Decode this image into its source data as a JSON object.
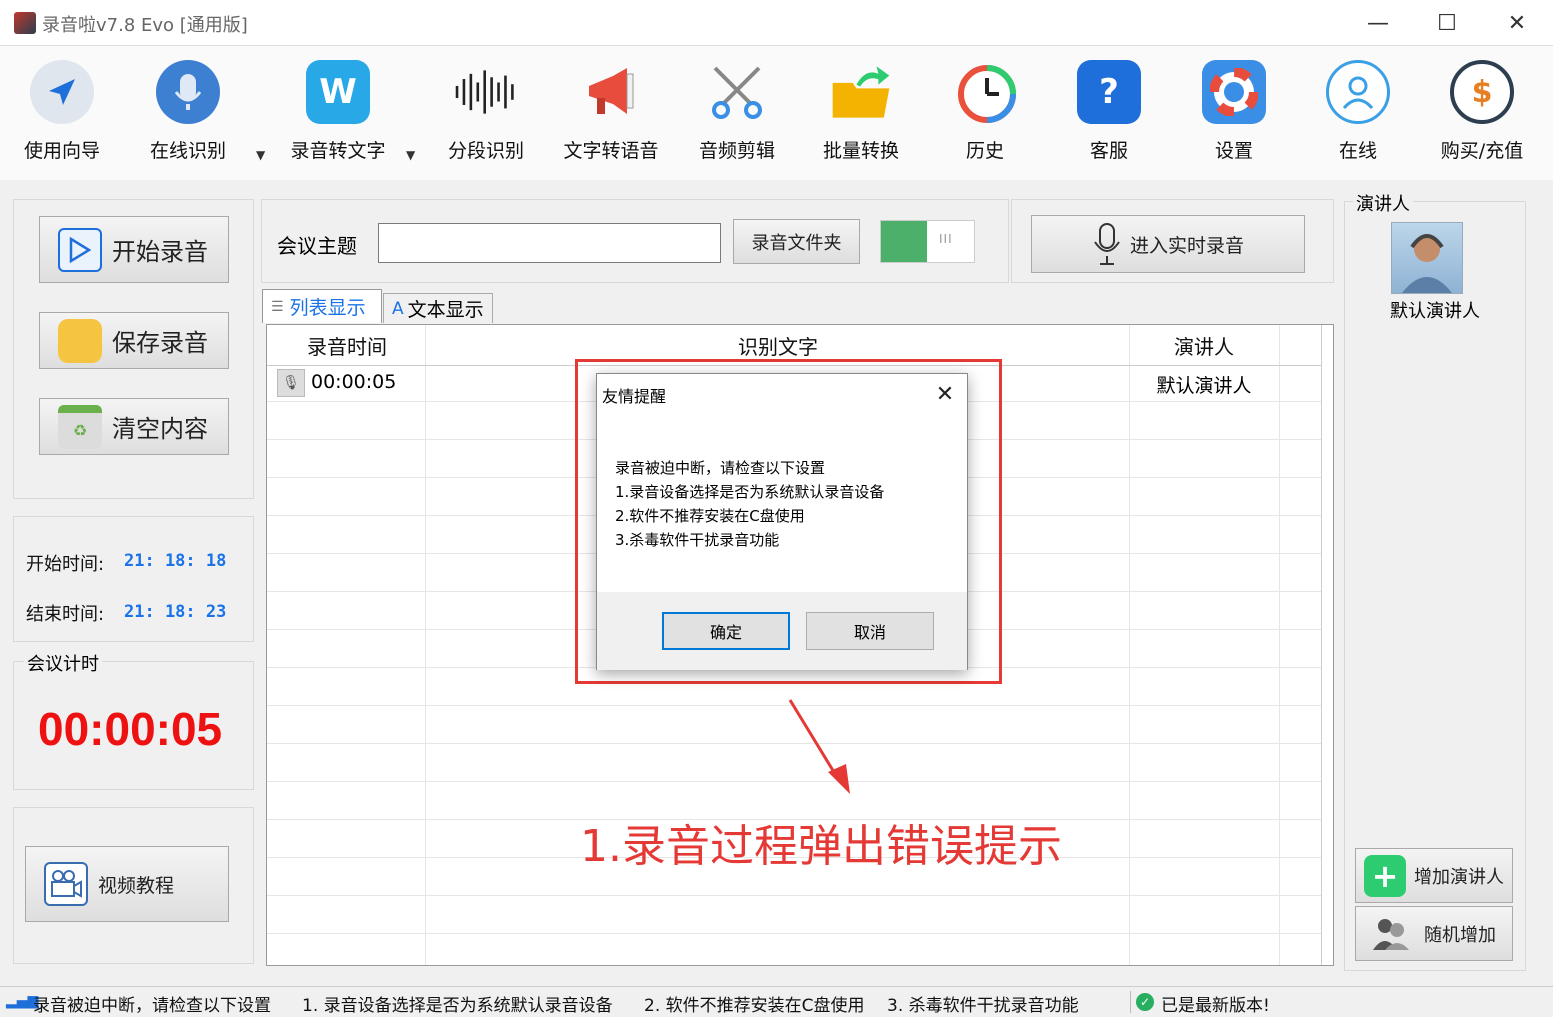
{
  "window": {
    "title": "录音啦v7.8 Evo [通用版]",
    "minimize": "—",
    "maximize": "☐",
    "close": "✕"
  },
  "toolbar": [
    {
      "label": "使用向导",
      "icon": "navigation-arrow-icon",
      "color": "#dfe6ee"
    },
    {
      "label": "在线识别",
      "icon": "microphone-icon",
      "color": "#3d7fd1"
    },
    {
      "label": "录音转文字",
      "icon": "w-logo-icon",
      "color": "#29a8e8"
    },
    {
      "label": "分段识别",
      "icon": "waveform-icon",
      "color": "#ffffff"
    },
    {
      "label": "文字转语音",
      "icon": "megaphone-icon",
      "color": "#e74c3c"
    },
    {
      "label": "音频剪辑",
      "icon": "scissors-icon",
      "color": "#6c7a89"
    },
    {
      "label": "批量转换",
      "icon": "folder-arrow-icon",
      "color": "#f5b301"
    },
    {
      "label": "历史",
      "icon": "clock-history-icon",
      "color": "#e9513d"
    },
    {
      "label": "客服",
      "icon": "question-icon",
      "color": "#1e6fd9"
    },
    {
      "label": "设置",
      "icon": "lifebuoy-icon",
      "color": "#3a8ee6"
    },
    {
      "label": "在线",
      "icon": "user-outline-icon",
      "color": "#3aa0e6"
    },
    {
      "label": "购买/充值",
      "icon": "coin-cursor-icon",
      "color": "#2c3e50"
    }
  ],
  "left": {
    "start_btn": "开始录音",
    "save_btn": "保存录音",
    "clear_btn": "清空内容",
    "start_time_label": "开始时间:",
    "start_time": "21: 18: 18",
    "end_time_label": "结束时间:",
    "end_time": "21: 18: 23",
    "timer_group": "会议计时",
    "timer": "00:00:05",
    "video_btn": "视频教程"
  },
  "topbar": {
    "topic_label": "会议主题",
    "topic_value": "",
    "folder_btn": "录音文件夹",
    "realtime_btn": "进入实时录音",
    "toggle_glyph": "III"
  },
  "tabs": [
    {
      "label": "列表显示"
    },
    {
      "label": "文本显示"
    }
  ],
  "grid": {
    "columns": [
      "录音时间",
      "识别文字",
      "演讲人"
    ],
    "rows": [
      {
        "time": "00:00:05",
        "text": "",
        "speaker": "默认演讲人"
      }
    ]
  },
  "speakers": {
    "group": "演讲人",
    "default": "默认演讲人",
    "add_btn": "增加演讲人",
    "random_btn": "随机增加"
  },
  "dialog": {
    "title": "友情提醒",
    "lines": [
      "录音被迫中断，请检查以下设置",
      "1.录音设备选择是否为系统默认录音设备",
      "2.软件不推荐安装在C盘使用",
      "3.杀毒软件干扰录音功能"
    ],
    "ok": "确定",
    "cancel": "取消"
  },
  "annotation": {
    "caption": "1.录音过程弹出错误提示",
    "color": "#e53935"
  },
  "status": {
    "msg1": "录音被迫中断，请检查以下设置",
    "msg2": "1. 录音设备选择是否为系统默认录音设备",
    "msg3": "2. 软件不推荐安装在C盘使用",
    "msg4": "3. 杀毒软件干扰录音功能",
    "version": "已是最新版本!"
  }
}
